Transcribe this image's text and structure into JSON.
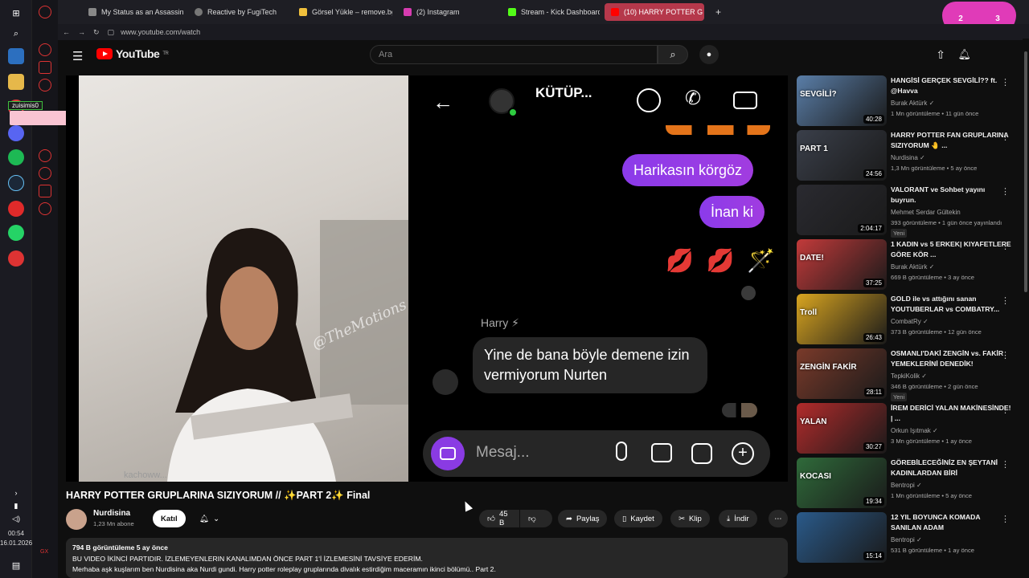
{
  "taskbar": {
    "time": "00:54",
    "date": "16.01.2026"
  },
  "tabs": [
    {
      "label": "My Status as an Assassin",
      "color": "#888888"
    },
    {
      "label": "Reactive by FugiTech",
      "color": "#777777"
    },
    {
      "label": "Görsel Yükle – remove.bg",
      "color": "#f0c03c"
    },
    {
      "label": "(2) Instagram",
      "color": "#d63cb0"
    },
    {
      "label": "Stream - Kick Dashboard",
      "color": "#53fc18"
    },
    {
      "label": "(10) HARRY POTTER G",
      "color": "#ff0000"
    }
  ],
  "browser": {
    "url": "www.youtube.com/watch",
    "overlay_label": "zuisimis0",
    "badge_left": "2",
    "badge_right": "3"
  },
  "yt": {
    "logo": "YouTube",
    "logo_sup": "TR",
    "search_placeholder": "Ara"
  },
  "video": {
    "watermark": "@TheMotions",
    "chat_header": "KÜTÜP...",
    "msg1": "Harikasın körgöz",
    "msg2": "İnan ki",
    "reactions": "💋 💋 🪄",
    "sender": "Harry ⚡",
    "reply": "Yine de bana böyle demene izin vermiyorum Nurten",
    "placeholder": "Mesaj...",
    "corner_caption": "kachoww..."
  },
  "meta": {
    "title": "HARRY POTTER GRUPLARINA SIZIYORUM // ✨PART 2✨ Final",
    "channel": "Nurdisina",
    "subs": "1,23 Mn abone",
    "join": "Katıl",
    "likes": "45 B",
    "share": "Paylaş",
    "save": "Kaydet",
    "clip": "Klip",
    "download": "İndir",
    "views_line": "794 B görüntüleme  5 ay önce",
    "desc1": "BU VIDEO İKİNCİ PARTIDIR. İZLEMEYENLERIN KANALIMDAN ÖNCE PART 1'İ İZLEMESİNİ TAVSİYE EDERİM.",
    "desc2": "Merhaba aşk kuşlarım ben Nurdisina aka Nurdi gundi.  Harry potter roleplay gruplarında divalık estirdiğim maceramın ikinci bölümü.. Part 2."
  },
  "recs": [
    {
      "title": "HANGİSİ GERÇEK SEVGİLİ?? ft. @Havva",
      "channel": "Burak Aktürk ✓",
      "meta": "1 Mn görüntüleme • 11 gün önce",
      "dur": "40:28",
      "color": "#5a7ea8",
      "thumb_text": "SEVGİLİ?"
    },
    {
      "title": "HARRY POTTER FAN GRUPLARINA SIZIYORUM 🤚 ...",
      "channel": "Nurdisina ✓",
      "meta": "1,3 Mn görüntüleme • 5 ay önce",
      "dur": "24:56",
      "color": "#3a3f4a",
      "thumb_text": "PART 1"
    },
    {
      "title": "VALORANT ve Sohbet yayını buyrun.",
      "channel": "Mehmet Serdar Gültekin",
      "meta": "393 görüntüleme • 1 gün önce yayınlandı",
      "dur": "2:04:17",
      "color": "#2a2a30",
      "new": "Yeni",
      "thumb_text": ""
    },
    {
      "title": "1 KADIN vs 5 ERKEK| KIYAFETLERE GÖRE KÖR ...",
      "channel": "Burak Aktürk ✓",
      "meta": "669 B görüntüleme • 3 ay önce",
      "dur": "37:25",
      "color": "#c23a3a",
      "thumb_text": "DATE!"
    },
    {
      "title": "GOLD ile vs attığını sanan YOUTUBERLAR vs COMBATRY...",
      "channel": "CombatRy ✓",
      "meta": "373 B görüntüleme • 12 gün önce",
      "dur": "26:43",
      "color": "#d9a520",
      "thumb_text": "Troll"
    },
    {
      "title": "OSMANLI'DAKİ ZENGİN vs. FAKİR YEMEKLERİNİ DENEDİK!",
      "channel": "TepkiKolik ✓",
      "meta": "346 B görüntüleme • 2 gün önce",
      "dur": "28:11",
      "color": "#7a3a2a",
      "new": "Yeni",
      "thumb_text": "ZENGİN FAKİR"
    },
    {
      "title": "İREM DERİCİ YALAN MAKİNESİNDE! | ...",
      "channel": "Orkun Işıtmak ✓",
      "meta": "3 Mn görüntüleme • 1 ay önce",
      "dur": "30:27",
      "color": "#b22b2b",
      "thumb_text": "YALAN"
    },
    {
      "title": "GÖREBİLECEĞİNİZ EN ŞEYTANİ KADINLARDAN BİRİ",
      "channel": "Bentropi ✓",
      "meta": "1 Mn görüntüleme • 5 ay önce",
      "dur": "19:34",
      "color": "#2f6a3a",
      "thumb_text": "KOCASI"
    },
    {
      "title": "12 YIL BOYUNCA KOMADA SANILAN ADAM",
      "channel": "Bentropi ✓",
      "meta": "531 B görüntüleme • 1 ay önce",
      "dur": "15:14",
      "color": "#2a5a8a",
      "thumb_text": ""
    }
  ]
}
